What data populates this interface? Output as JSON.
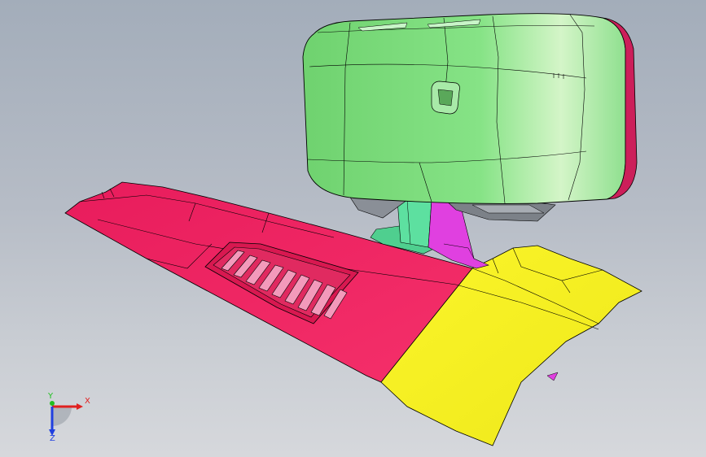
{
  "viewport": {
    "background_top": "#a3adba",
    "background_bottom": "#d6d8dc"
  },
  "model": {
    "parts": [
      {
        "name": "housing",
        "color": "#7fde7f"
      },
      {
        "name": "housing-rim",
        "color": "#cc1f5a"
      },
      {
        "name": "base-panel",
        "color": "#f0245e"
      },
      {
        "name": "end-cap",
        "color": "#f7f21f"
      },
      {
        "name": "post",
        "color": "#5de0a0"
      },
      {
        "name": "bracket",
        "color": "#e040e0"
      },
      {
        "name": "vent-slats",
        "color": "#f08fb0"
      }
    ],
    "edge_color": "#000000"
  },
  "triad": {
    "x_label": "X",
    "y_label": "Y",
    "z_label": "Z",
    "x_color": "#e02020",
    "y_color": "#20c020",
    "z_color": "#2040e0"
  }
}
